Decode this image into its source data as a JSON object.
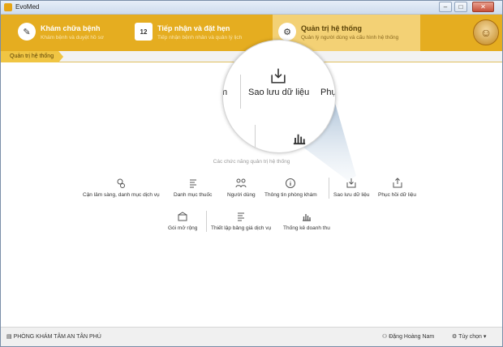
{
  "window": {
    "title": "EvoMed",
    "controls": [
      "–",
      "□",
      "✕"
    ]
  },
  "ribbon": {
    "colors": {
      "bar": "#e5ad20",
      "active": "#f3d175"
    },
    "tabs": [
      {
        "title": "Khám chữa bệnh",
        "subtitle": "Khám bệnh và duyệt hồ sơ",
        "icon": "clipboard-edit-icon",
        "glyph": "✎"
      },
      {
        "title": "Tiếp nhận và đặt hẹn",
        "subtitle": "Tiếp nhận bệnh nhân và quản lý lịch",
        "icon": "calendar-icon",
        "glyph": "12"
      },
      {
        "title": "Quản trị hệ thống",
        "subtitle": "Quản lý người dùng và cấu hình hệ thống",
        "icon": "settings-icon",
        "glyph": "⚙"
      }
    ]
  },
  "breadcrumb": {
    "label": "Quản trị hệ thống"
  },
  "main": {
    "section_label": "Các chức năng quản trị hệ thống",
    "row1": [
      {
        "label": "Cận lâm sàng, danh mục dịch vụ",
        "icon": "lab-service-icon"
      },
      {
        "label": "Danh mục thuốc",
        "icon": "drug-list-icon"
      },
      {
        "label": "Người dùng",
        "icon": "users-icon"
      },
      {
        "label": "Thông tin phòng khám",
        "icon": "info-icon"
      },
      {
        "label": "Sao lưu dữ liệu",
        "icon": "backup-icon"
      },
      {
        "label": "Phục hồi dữ liệu",
        "icon": "restore-icon"
      }
    ],
    "row2": [
      {
        "label": "Gói mở rộng",
        "icon": "extension-package-icon"
      },
      {
        "label": "Thiết lập bảng giá dịch vụ",
        "icon": "price-list-icon"
      },
      {
        "label": "Thống kê doanh thu",
        "icon": "revenue-chart-icon"
      }
    ]
  },
  "magnifier": {
    "left_fragment": "m",
    "center_label": "Sao lưu dữ liệu",
    "right_fragment": "Phụ"
  },
  "status": {
    "clinic": "PHÒNG KHÁM TÂM AN TÂN PHÚ",
    "user": "Đặng Hoàng Nam",
    "options": "Tùy chọn"
  }
}
